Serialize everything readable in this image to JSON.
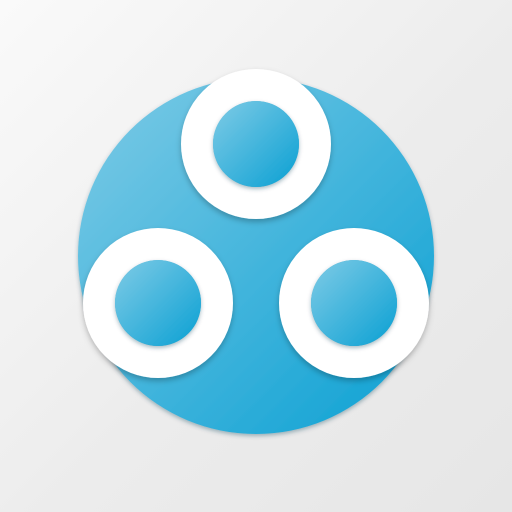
{
  "app_icon": {
    "icon": "three-rings-logo-icon",
    "colors": {
      "background": "#eeeeee",
      "disc_light": "#7fcbe6",
      "disc_dark": "#0aa0d3",
      "ring": "#ffffff"
    }
  }
}
